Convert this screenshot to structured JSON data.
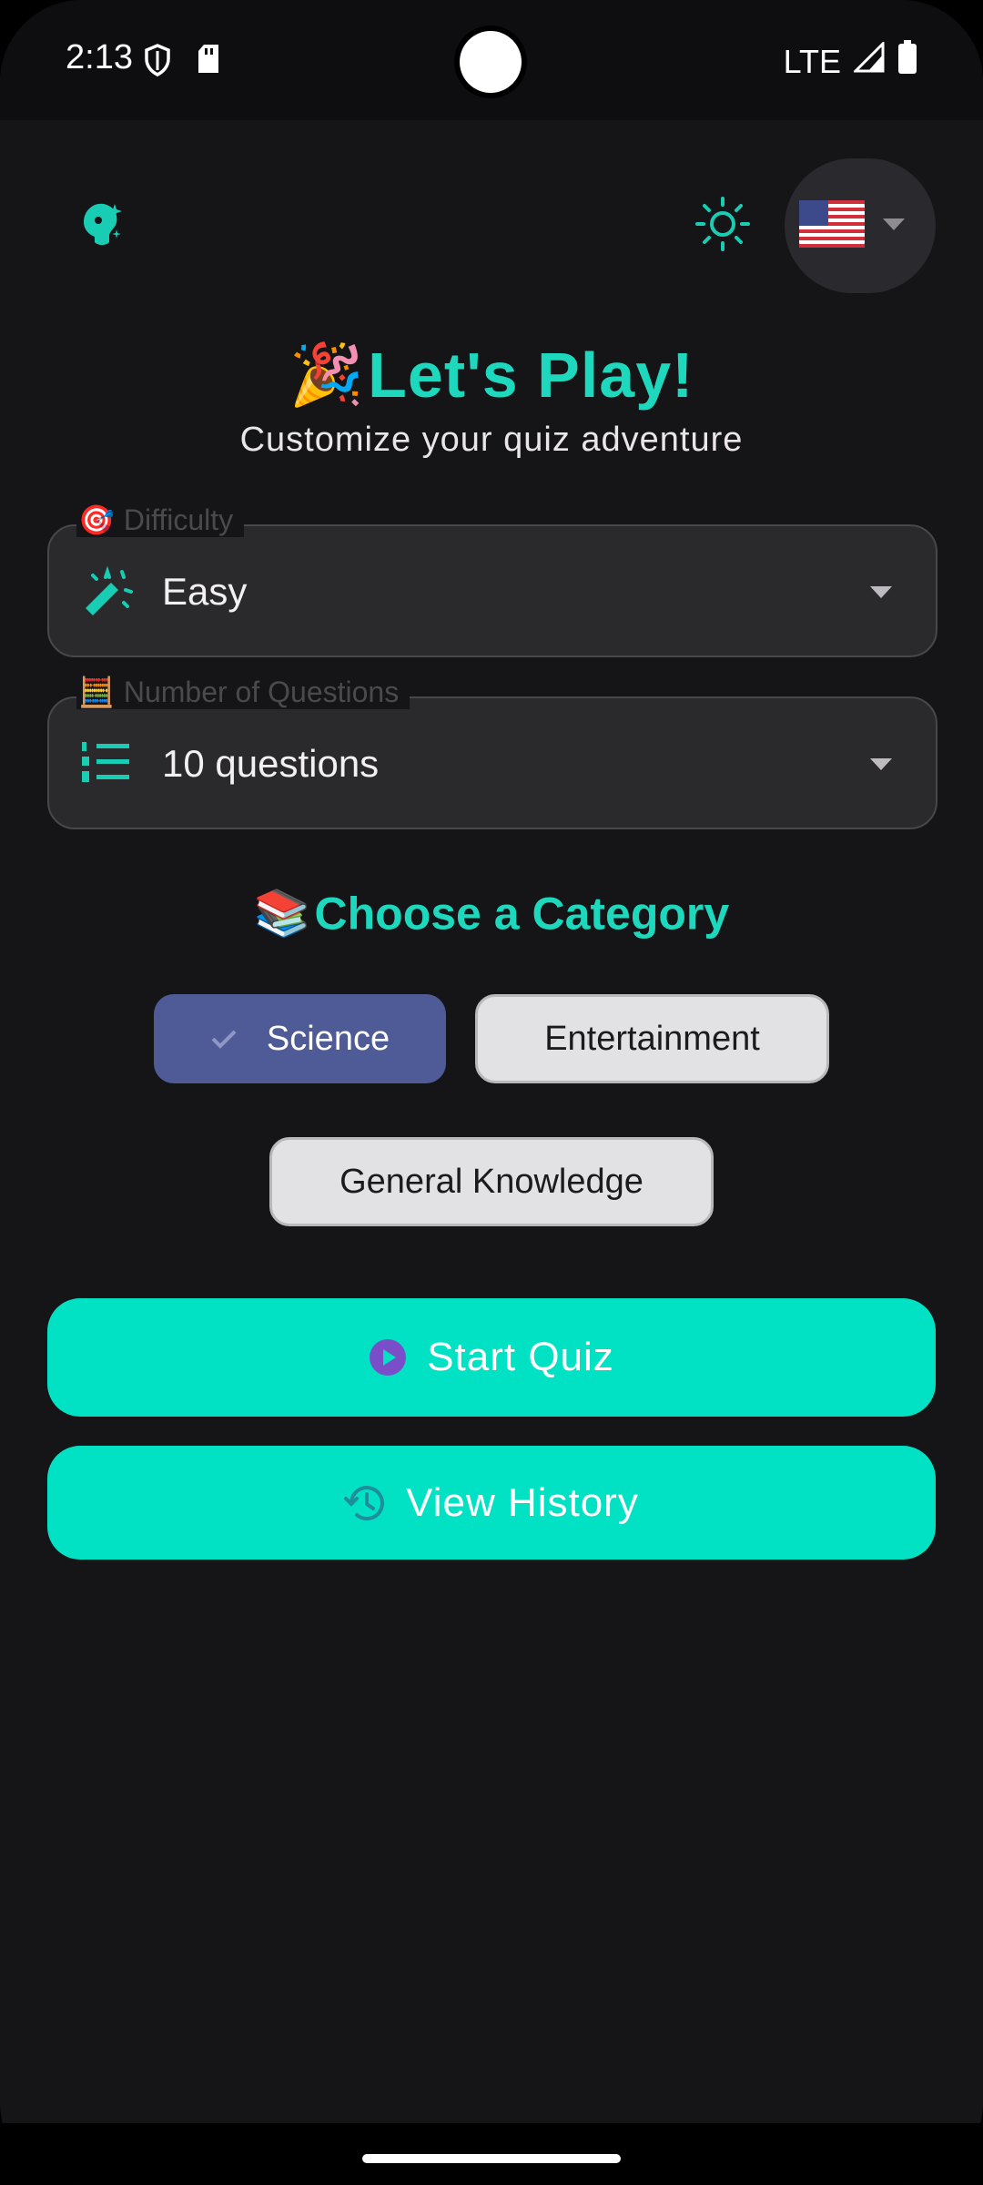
{
  "status_bar": {
    "time": "2:13",
    "network": "LTE"
  },
  "header": {
    "language_flag": "🇺🇸",
    "theme_icon": "sun-icon",
    "logo_icon": "brain-bulb-icon"
  },
  "hero": {
    "emoji": "🎉",
    "title": "Let's Play!",
    "subtitle": "Customize your quiz adventure"
  },
  "difficulty": {
    "label_emoji": "🎯",
    "label": "Difficulty",
    "value": "Easy",
    "icon": "magic-wand-icon"
  },
  "questions": {
    "label_emoji": "🧮",
    "label": "Number of Questions",
    "value": "10 questions",
    "icon": "numbered-list-icon"
  },
  "category": {
    "emoji": "📚",
    "heading": "Choose a Category",
    "chips": [
      {
        "label": "Science",
        "selected": true
      },
      {
        "label": "Entertainment",
        "selected": false
      },
      {
        "label": "General Knowledge",
        "selected": false
      }
    ]
  },
  "actions": {
    "start_label": "Start Quiz",
    "history_label": "View History"
  },
  "colors": {
    "accent": "#00e2c3",
    "heading": "#1ed8bd",
    "selected_chip": "#4f5b96",
    "background": "#151417"
  }
}
